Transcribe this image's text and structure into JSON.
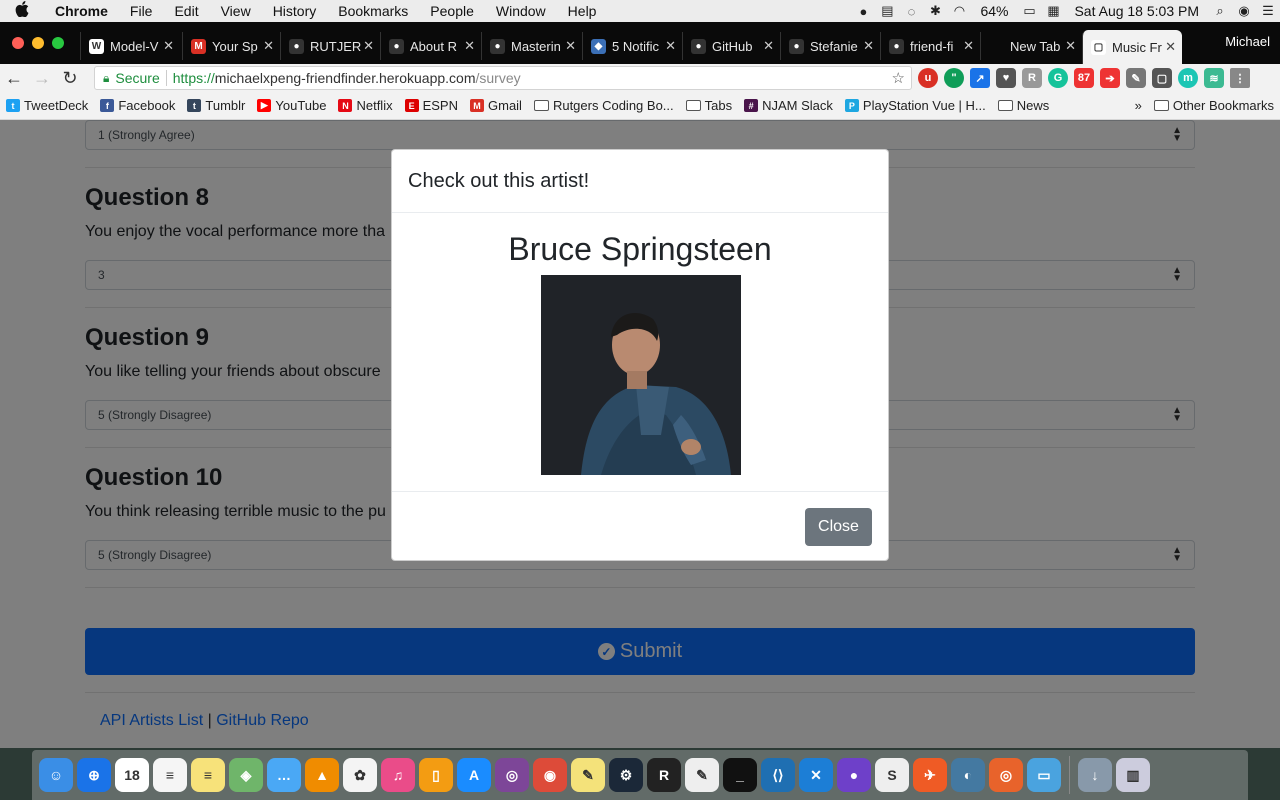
{
  "menubar": {
    "apple": "",
    "app": "Chrome",
    "items": [
      "File",
      "Edit",
      "View",
      "History",
      "Bookmarks",
      "People",
      "Window",
      "Help"
    ],
    "battery": "64%",
    "datetime": "Sat Aug 18  5:03 PM"
  },
  "tabs": [
    {
      "label": "Model-V",
      "icon": "W",
      "color": "#fff"
    },
    {
      "label": "Your Sp",
      "icon": "M",
      "color": "#d93025"
    },
    {
      "label": "RUTJER",
      "icon": "●",
      "color": "#333"
    },
    {
      "label": "About R",
      "icon": "●",
      "color": "#333"
    },
    {
      "label": "Masterin",
      "icon": "●",
      "color": "#333"
    },
    {
      "label": "5 Notific",
      "icon": "◆",
      "color": "#3b6fb6"
    },
    {
      "label": "GitHub",
      "icon": "●",
      "color": "#333"
    },
    {
      "label": "Stefanie",
      "icon": "●",
      "color": "#333"
    },
    {
      "label": "friend-fi",
      "icon": "●",
      "color": "#333"
    },
    {
      "label": "New Tab",
      "icon": "",
      "color": "transparent"
    },
    {
      "label": "Music Fr",
      "icon": "▢",
      "color": "#fff"
    }
  ],
  "profile": "Michael",
  "address": {
    "secure": "Secure",
    "scheme": "https://",
    "host": "michaelxpeng-friendfinder.herokuapp.com",
    "path": "/survey"
  },
  "bookmarks": [
    {
      "label": "TweetDeck",
      "type": "icon",
      "color": "#1da1f2",
      "glyph": "t"
    },
    {
      "label": "Facebook",
      "type": "icon",
      "color": "#3b5998",
      "glyph": "f"
    },
    {
      "label": "Tumblr",
      "type": "icon",
      "color": "#35465c",
      "glyph": "t"
    },
    {
      "label": "YouTube",
      "type": "icon",
      "color": "#ff0000",
      "glyph": "▶"
    },
    {
      "label": "Netflix",
      "type": "icon",
      "color": "#e50914",
      "glyph": "N"
    },
    {
      "label": "ESPN",
      "type": "icon",
      "color": "#d00",
      "glyph": "E"
    },
    {
      "label": "Gmail",
      "type": "icon",
      "color": "#d93025",
      "glyph": "M"
    },
    {
      "label": "Rutgers Coding Bo...",
      "type": "folder"
    },
    {
      "label": "Tabs",
      "type": "folder"
    },
    {
      "label": "NJAM Slack",
      "type": "icon",
      "color": "#4a154b",
      "glyph": "#"
    },
    {
      "label": "PlayStation Vue | H...",
      "type": "icon",
      "color": "#1ea7e1",
      "glyph": "P"
    },
    {
      "label": "News",
      "type": "folder"
    }
  ],
  "bookmarks_more": "»",
  "other_bookmarks": "Other Bookmarks",
  "survey": {
    "q7_answer": "1 (Strongly Agree)",
    "questions": [
      {
        "title": "Question 8",
        "text": "You enjoy the vocal performance more tha",
        "answer": "3"
      },
      {
        "title": "Question 9",
        "text": "You like telling your friends about obscure",
        "answer": "5 (Strongly Disagree)"
      },
      {
        "title": "Question 10",
        "text": "You think releasing terrible music to the pu",
        "answer": "5 (Strongly Disagree)"
      }
    ],
    "submit": "Submit",
    "footer_link1": "API Artists List",
    "footer_sep": "|",
    "footer_link2": "GitHub Repo"
  },
  "modal": {
    "title": "Check out this artist!",
    "artist": "Bruce Springsteen",
    "close": "Close"
  },
  "dock": [
    {
      "name": "finder",
      "color": "#3a8ee6",
      "glyph": "☺"
    },
    {
      "name": "safari",
      "color": "#1a73e8",
      "glyph": "⊕"
    },
    {
      "name": "calendar",
      "color": "#ffffff",
      "glyph": "18"
    },
    {
      "name": "reminders",
      "color": "#f5f5f5",
      "glyph": "≡"
    },
    {
      "name": "notes",
      "color": "#f7e27a",
      "glyph": "≡"
    },
    {
      "name": "maps",
      "color": "#6fb56a",
      "glyph": "◈"
    },
    {
      "name": "messages",
      "color": "#4aa8f5",
      "glyph": "…"
    },
    {
      "name": "vlc",
      "color": "#f08c00",
      "glyph": "▲"
    },
    {
      "name": "photos",
      "color": "#f4f4f4",
      "glyph": "✿"
    },
    {
      "name": "itunes",
      "color": "#ea4c89",
      "glyph": "♫"
    },
    {
      "name": "ibooks",
      "color": "#f39c12",
      "glyph": "▯"
    },
    {
      "name": "app-store",
      "color": "#1a8cff",
      "glyph": "A"
    },
    {
      "name": "tor",
      "color": "#7d4698",
      "glyph": "◎"
    },
    {
      "name": "chrome",
      "color": "#dd4b39",
      "glyph": "◉"
    },
    {
      "name": "stickies",
      "color": "#f4e27a",
      "glyph": "✎"
    },
    {
      "name": "steam",
      "color": "#1b2838",
      "glyph": "⚙"
    },
    {
      "name": "r-app",
      "color": "#222",
      "glyph": "R"
    },
    {
      "name": "textedit",
      "color": "#eee",
      "glyph": "✎"
    },
    {
      "name": "terminal",
      "color": "#111",
      "glyph": "_"
    },
    {
      "name": "vscode",
      "color": "#1f6fb2",
      "glyph": "⟨⟩"
    },
    {
      "name": "xcode",
      "color": "#1c7ed6",
      "glyph": "✕"
    },
    {
      "name": "github-desktop",
      "color": "#6e40c9",
      "glyph": "●"
    },
    {
      "name": "slack",
      "color": "#eee",
      "glyph": "S"
    },
    {
      "name": "postman",
      "color": "#ef5b25",
      "glyph": "✈"
    },
    {
      "name": "mysql",
      "color": "#4479a1",
      "glyph": "◐"
    },
    {
      "name": "sequel",
      "color": "#e8632b",
      "glyph": "◎"
    },
    {
      "name": "screen",
      "color": "#4aa3df",
      "glyph": "▭"
    },
    {
      "name": "downloads",
      "color": "#8899aa",
      "glyph": "↓"
    },
    {
      "name": "trash",
      "color": "#ccd",
      "glyph": "▥"
    }
  ]
}
